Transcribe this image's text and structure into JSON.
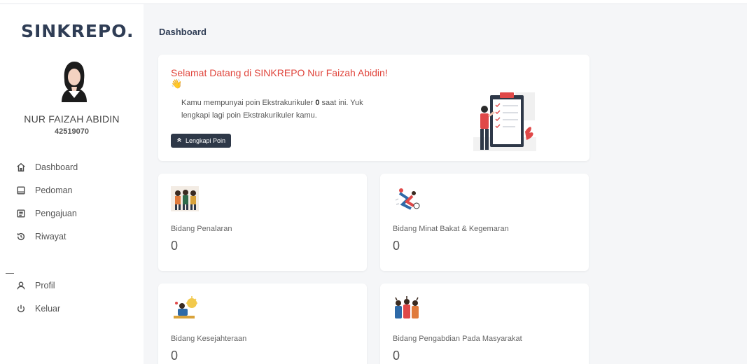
{
  "brand": "SINKREPO.",
  "user": {
    "name": "NUR FAIZAH ABIDIN",
    "id": "42519070"
  },
  "nav": [
    {
      "label": "Dashboard",
      "icon": "home-icon"
    },
    {
      "label": "Pedoman",
      "icon": "book-icon"
    },
    {
      "label": "Pengajuan",
      "icon": "document-icon"
    },
    {
      "label": "Riwayat",
      "icon": "history-icon"
    }
  ],
  "nav_bottom": [
    {
      "label": "Profil",
      "icon": "user-icon"
    },
    {
      "label": "Keluar",
      "icon": "power-icon"
    }
  ],
  "page_title": "Dashboard",
  "welcome": {
    "title": "Selamat Datang di SINKREPO Nur Faizah Abidin!",
    "wave": "👋",
    "text_before": "Kamu mempunyai poin Ekstrakurikuler ",
    "points": "0",
    "text_after": " saat ini. Yuk lengkapi lagi poin Ekstrakurikuler kamu.",
    "button": "Lengkapi Poin",
    "button_icon": "double-chevron-up-icon"
  },
  "stats": [
    {
      "label": "Bidang Penalaran",
      "value": "0"
    },
    {
      "label": "Bidang Minat Bakat & Kegemaran",
      "value": "0"
    },
    {
      "label": "Bidang Kesejahteraan",
      "value": "0"
    },
    {
      "label": "Bidang Pengabdian Pada Masyarakat",
      "value": "0"
    }
  ],
  "colors": {
    "accent": "#2e3848",
    "welcome_title": "#e0453c",
    "brand": "#2f3d55"
  }
}
